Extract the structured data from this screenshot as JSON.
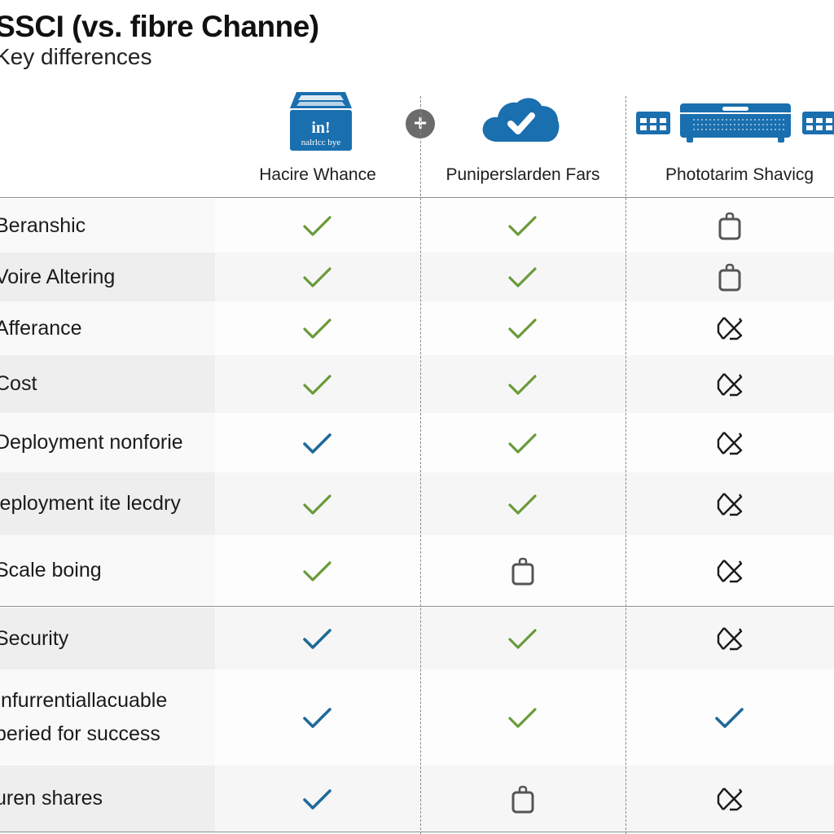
{
  "header": {
    "title": "SSCI (vs. fibre Channe)",
    "subtitle": "Key differences"
  },
  "columns": [
    {
      "label": "Hacire Whance",
      "icon": "storage-box-icon",
      "icon_text_top": "in!",
      "icon_text_bottom": "nalrlcc bye"
    },
    {
      "label": "Puniperslarden Fars",
      "icon": "cloud-check-icon"
    },
    {
      "label": "Phototarim Shavicg",
      "icon": "server-rack-icon"
    }
  ],
  "separator_icon": "plus-icon",
  "colors": {
    "brand_blue": "#1a6faf",
    "check_green": "#6a9a3a",
    "check_blue": "#1f6a98",
    "neutral_icon": "#555555"
  },
  "rows": [
    {
      "label": [
        "Beranshic"
      ],
      "values": [
        "check-green",
        "check-green",
        "bag"
      ]
    },
    {
      "label": [
        "Voire Altering"
      ],
      "values": [
        "check-green",
        "check-green",
        "bag"
      ]
    },
    {
      "label": [
        "Afferance"
      ],
      "values": [
        "check-green",
        "check-green",
        "cross"
      ]
    },
    {
      "label": [
        "Cost"
      ],
      "values": [
        "check-green",
        "check-green",
        "cross"
      ]
    },
    {
      "label": [
        "Deployment nonforie"
      ],
      "values": [
        "check-blue",
        "check-green",
        "cross"
      ]
    },
    {
      "label": [
        "leployment ite lecdry"
      ],
      "values": [
        "check-green",
        "check-green",
        "cross"
      ]
    },
    {
      "label": [
        "Scale boing"
      ],
      "values": [
        "check-green",
        "bag",
        "cross"
      ]
    },
    {
      "label": [
        "Security"
      ],
      "values": [
        "check-blue",
        "check-green",
        "cross"
      ]
    },
    {
      "label": [
        "Infurrentiallacuable",
        "peried for success"
      ],
      "values": [
        "check-blue",
        "check-green",
        "check-blue"
      ]
    },
    {
      "label": [
        "uren shares"
      ],
      "values": [
        "check-blue",
        "bag",
        "cross"
      ]
    }
  ]
}
